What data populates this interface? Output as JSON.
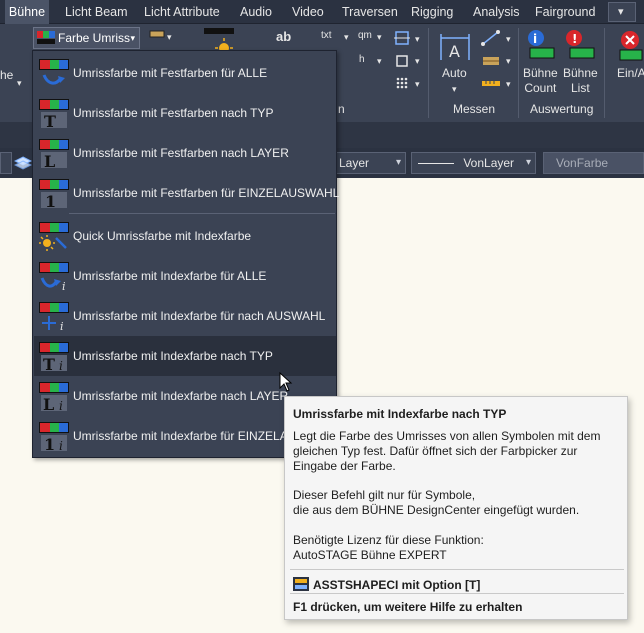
{
  "tabs": [
    {
      "label": "Bühne",
      "active": true
    },
    {
      "label": "Licht Beam"
    },
    {
      "label": "Licht Attribute"
    },
    {
      "label": "Audio"
    },
    {
      "label": "Video"
    },
    {
      "label": "Traversen"
    },
    {
      "label": "Rigging"
    },
    {
      "label": "Analysis"
    },
    {
      "label": "Fairground"
    }
  ],
  "ribbon": {
    "dropdown_label": "Farbe Umriss",
    "left_cut_label": "he",
    "messen": {
      "auto_label": "Auto",
      "panel_label": "Messen"
    },
    "auswertung": {
      "count_label": "Bühne\nCount",
      "list_label": "Bühne\nList",
      "panel_label": "Auswertung"
    },
    "ein_label": "Ein/A",
    "partial_panel_label": "n",
    "small_labels": {
      "txt": "txt",
      "qm": "qm",
      "ab": "ab",
      "h": "h"
    }
  },
  "propbar": {
    "layer_combo": "Layer",
    "linetype_combo": "VonLayer",
    "color_combo": "VonFarbe"
  },
  "menu": {
    "items": [
      {
        "label": "Umrissfarbe mit Festfarben für ALLE",
        "icon": "rgb-arrow-icon"
      },
      {
        "label": "Umrissfarbe mit Festfarben nach TYP",
        "icon": "rgb-type-icon"
      },
      {
        "label": "Umrissfarbe mit Festfarben nach LAYER",
        "icon": "rgb-layer-icon"
      },
      {
        "label": "Umrissfarbe mit Festfarben für EINZELAUSWAHL",
        "icon": "rgb-single-icon"
      },
      {
        "label": "Quick Umrissfarbe mit Indexfarbe",
        "icon": "rgb-sun-icon"
      },
      {
        "label": "Umrissfarbe mit Indexfarbe für ALLE",
        "icon": "rgb-arrow-i-icon"
      },
      {
        "label": "Umrissfarbe mit Indexfarbe für nach AUSWAHL",
        "icon": "rgb-select-i-icon"
      },
      {
        "label": "Umrissfarbe mit Indexfarbe nach TYP",
        "icon": "rgb-type-i-icon",
        "hover": true
      },
      {
        "label": "Umrissfarbe mit Indexfarbe nach LAYER",
        "icon": "rgb-layer-i-icon"
      },
      {
        "label": "Umrissfarbe mit Indexfarbe für EINZELAU",
        "icon": "rgb-single-i-icon"
      }
    ]
  },
  "tooltip": {
    "title": "Umrissfarbe mit Indexfarbe nach TYP",
    "desc": "Legt die Farbe des Umrisses von allen Symbolen mit dem gleichen Typ fest. Dafür öffnet sich der Farbpicker zur Eingabe der Farbe.",
    "note_line1": "Dieser Befehl gilt nur für Symbole,",
    "note_line2": "die aus dem BÜHNE DesignCenter eingefügt wurden.",
    "license_label": "Benötigte Lizenz für diese Funktion:",
    "license_value": "AutoSTAGE Bühne EXPERT",
    "command": "ASSTSHAPECI mit Option [T]",
    "help": "F1 drücken, um weitere Hilfe zu erhalten"
  },
  "colors": {
    "accent_red": "#d9262b",
    "accent_green": "#27b34a",
    "accent_blue": "#2a6bd6"
  }
}
